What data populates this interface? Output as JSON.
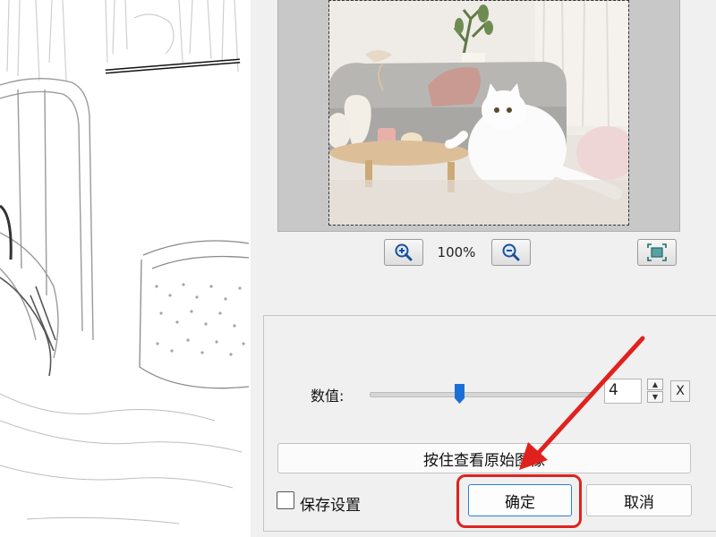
{
  "zoom": {
    "level": "100%"
  },
  "settings": {
    "value_label": "数值:",
    "value": "4",
    "slider_fraction": 0.4,
    "reset_label": "X"
  },
  "buttons": {
    "view_original": "按住查看原始图像",
    "save_settings": "保存设置",
    "save_checked": false,
    "ok": "确定",
    "cancel": "取消"
  },
  "colors": {
    "highlight": "#e0221e",
    "primary_border": "#2a7de1"
  },
  "icons": {
    "zoom_in": "zoom-in-icon",
    "zoom_out": "zoom-out-icon",
    "fit": "fit-to-window-icon"
  }
}
